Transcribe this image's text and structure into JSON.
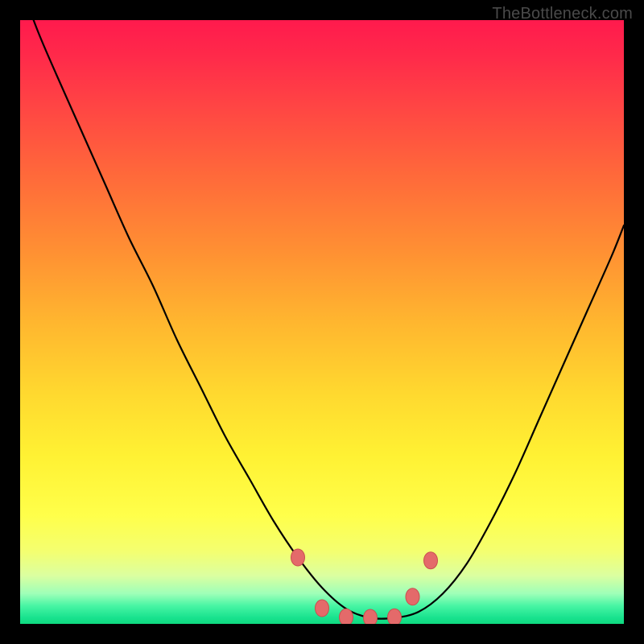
{
  "watermark": "TheBottleneck.com",
  "colors": {
    "curve": "#000000",
    "marker_fill": "#e46a6a",
    "marker_stroke": "#c94f4f",
    "frame": "#000000"
  },
  "chart_data": {
    "type": "line",
    "title": "",
    "xlabel": "",
    "ylabel": "",
    "xlim": [
      0,
      100
    ],
    "ylim": [
      0,
      100
    ],
    "grid": false,
    "legend": null,
    "series": [
      {
        "name": "bottleneck-curve",
        "x": [
          0,
          3,
          6,
          10,
          14,
          18,
          22,
          26,
          30,
          34,
          38,
          42,
          46,
          50,
          54,
          58,
          62,
          66,
          70,
          74,
          78,
          82,
          86,
          90,
          94,
          98,
          100
        ],
        "values": [
          106,
          98,
          91,
          82,
          73,
          64,
          56,
          47,
          39,
          31,
          24,
          17,
          11,
          6,
          2.5,
          1,
          1,
          2,
          5,
          10,
          17,
          25,
          34,
          43,
          52,
          61,
          66
        ]
      }
    ],
    "markers": {
      "name": "selected-points",
      "x": [
        46,
        50,
        54,
        58,
        62,
        65,
        68
      ],
      "values": [
        11,
        2.6,
        1.1,
        1.0,
        1.1,
        4.5,
        10.5
      ]
    }
  }
}
